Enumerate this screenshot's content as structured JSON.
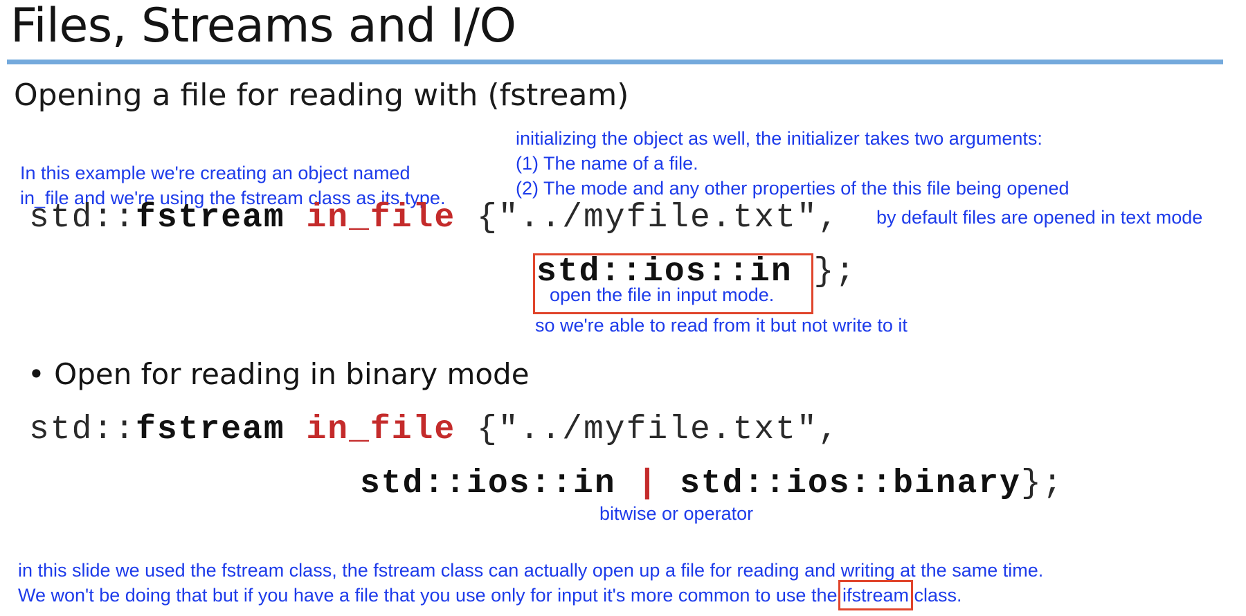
{
  "slide": {
    "title": "Files, Streams and I/O",
    "subtitle": "Opening a file for reading with (fstream)",
    "bullet": "Open for reading in binary mode"
  },
  "code1": {
    "line1_std": "std::",
    "line1_type": "fstream",
    "line1_var": "in_file",
    "line1_rest": "{\"../myfile.txt\",",
    "line2_mode": "std::ios::in",
    "line2_end": "};"
  },
  "code2": {
    "line1_std": "std::",
    "line1_type": "fstream",
    "line1_var": "in_file",
    "line1_rest": "{\"../myfile.txt\",",
    "line2_mode1": "std::ios::in",
    "line2_pipe": "|",
    "line2_mode2": "std::ios::binary",
    "line2_end": "};"
  },
  "notes": {
    "object_line1": "In this example we're creating an object named",
    "object_line2": "in_file and we're using the fstream class as its type.",
    "init_line1": "initializing the object as well, the initializer takes two arguments:",
    "init_line2": "(1) The name of a file.",
    "init_line3": "(2) The mode and any other properties of the this file being opened",
    "default_mode": "by default files are opened in text mode",
    "input_mode": "open the file in input mode.",
    "read_only": "so we're able to read from it but not write to it",
    "bitwise_or": "bitwise or operator",
    "footer_line1": "in this slide we used the fstream class, the fstream class can actually open up a file for reading and writing at the same time.",
    "footer_line2_pre": "We won't be doing that but if you have a file that you use only for input it's more common to use the",
    "footer_line2_hl": "ifstream",
    "footer_line2_post": "class."
  },
  "colors": {
    "annotation": "#1d3bea",
    "keyword": "#c42b2b",
    "highlight_box": "#e0452c",
    "title_rule": "#74a9dc"
  }
}
